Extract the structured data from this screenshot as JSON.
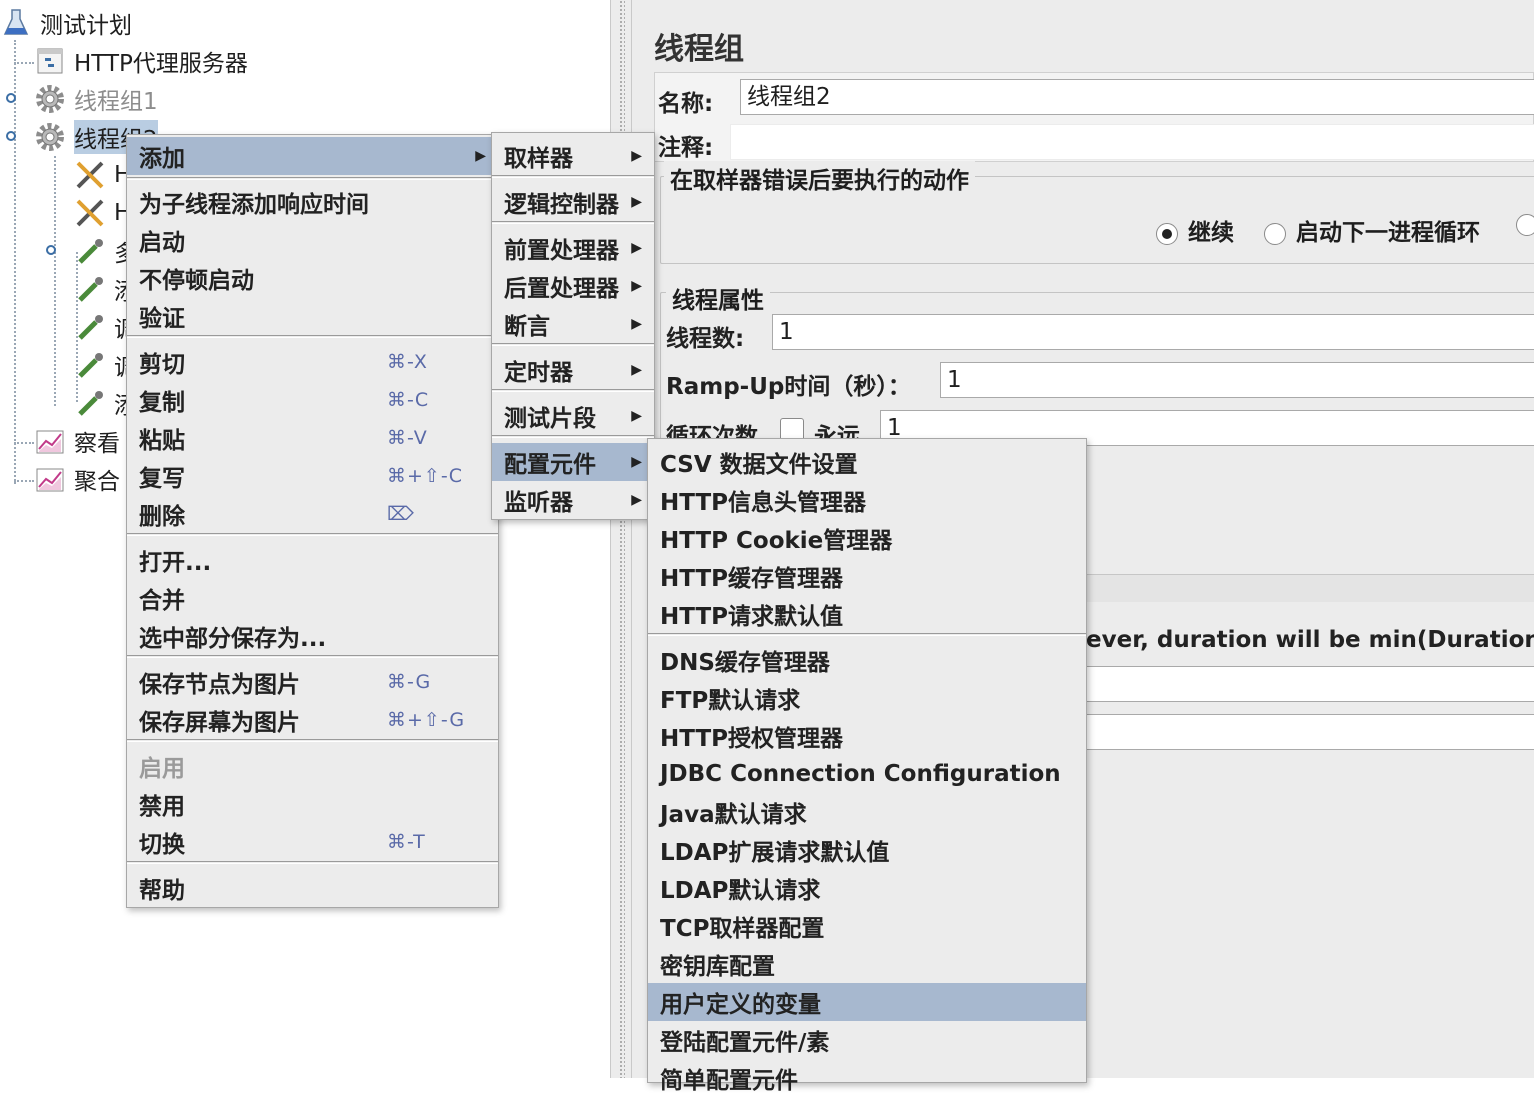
{
  "tree": {
    "items": [
      {
        "label": "测试计划"
      },
      {
        "label": "HTTP代理服务器"
      },
      {
        "label": "线程组1"
      },
      {
        "label": "线程组2"
      },
      {
        "label": "H"
      },
      {
        "label": "H"
      },
      {
        "label": "多"
      },
      {
        "label": "添"
      },
      {
        "label": "调"
      },
      {
        "label": "调"
      },
      {
        "label": "添"
      },
      {
        "label": "察看"
      },
      {
        "label": "聚合"
      }
    ]
  },
  "panel": {
    "title": "线程组",
    "name_label": "名称:",
    "name_value": "线程组2",
    "comment_label": "注释:",
    "comment_value": "",
    "on_error_group": "在取样器错误后要执行的动作",
    "on_error_options": [
      "继续",
      "启动下一进程循环"
    ],
    "thread_group_title": "线程属性",
    "threads_label": "线程数:",
    "threads_value": "1",
    "rampup_label": "Ramp-Up时间（秒）：",
    "rampup_value": "1",
    "loop_label": "循环次数",
    "forever_label": "永远",
    "loop_value": "1",
    "scheduler_note": "ever, duration will be min(Duration, l"
  },
  "context_menu": {
    "items": [
      {
        "label": "添加",
        "submenu": true
      },
      {
        "label": "为子线程添加响应时间"
      },
      {
        "label": "启动"
      },
      {
        "label": "不停顿启动"
      },
      {
        "label": "验证"
      },
      {
        "label": "剪切",
        "shortcut": "⌘-X"
      },
      {
        "label": "复制",
        "shortcut": "⌘-C"
      },
      {
        "label": "粘贴",
        "shortcut": "⌘-V"
      },
      {
        "label": "复写",
        "shortcut": "⌘+⇧-C"
      },
      {
        "label": "删除",
        "shortcut": "⌦"
      },
      {
        "label": "打开..."
      },
      {
        "label": "合并"
      },
      {
        "label": "选中部分保存为..."
      },
      {
        "label": "保存节点为图片",
        "shortcut": "⌘-G"
      },
      {
        "label": "保存屏幕为图片",
        "shortcut": "⌘+⇧-G"
      },
      {
        "label": "启用"
      },
      {
        "label": "禁用"
      },
      {
        "label": "切换",
        "shortcut": "⌘-T"
      },
      {
        "label": "帮助"
      }
    ]
  },
  "add_menu": {
    "items": [
      {
        "label": "取样器"
      },
      {
        "label": "逻辑控制器"
      },
      {
        "label": "前置处理器"
      },
      {
        "label": "后置处理器"
      },
      {
        "label": "断言"
      },
      {
        "label": "定时器"
      },
      {
        "label": "测试片段"
      },
      {
        "label": "配置元件"
      },
      {
        "label": "监听器"
      }
    ]
  },
  "config_menu": {
    "items": [
      {
        "label": "CSV 数据文件设置"
      },
      {
        "label": "HTTP信息头管理器"
      },
      {
        "label": "HTTP Cookie管理器"
      },
      {
        "label": "HTTP缓存管理器"
      },
      {
        "label": "HTTP请求默认值"
      },
      {
        "label": "DNS缓存管理器"
      },
      {
        "label": "FTP默认请求"
      },
      {
        "label": "HTTP授权管理器"
      },
      {
        "label": "JDBC Connection Configuration"
      },
      {
        "label": "Java默认请求"
      },
      {
        "label": "LDAP扩展请求默认值"
      },
      {
        "label": "LDAP默认请求"
      },
      {
        "label": "TCP取样器配置"
      },
      {
        "label": "密钥库配置"
      },
      {
        "label": "用户定义的变量"
      },
      {
        "label": "登陆配置元件/素"
      },
      {
        "label": "简单配置元件"
      }
    ]
  },
  "colors": {
    "menu_highlight": "#a7b8cf",
    "tree_selection": "#b9cde2",
    "panel_bg": "#ececec"
  }
}
